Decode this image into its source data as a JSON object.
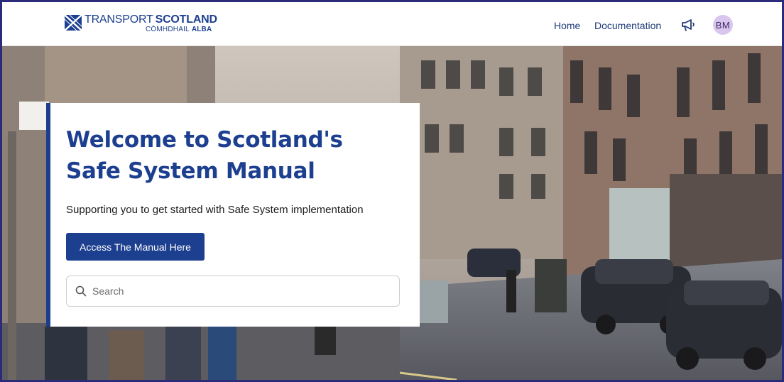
{
  "brand": {
    "name_light": "TRANSPORT",
    "name_bold": "SCOTLAND",
    "gaelic_light": "CÒMHDHAIL",
    "gaelic_bold": "ALBA",
    "color": "#1d3f8f"
  },
  "nav": {
    "home": "Home",
    "documentation": "Documentation",
    "announcement_icon": "megaphone-icon",
    "avatar_initials": "BM",
    "avatar_color": "#d9c6ee"
  },
  "hero": {
    "title": "Welcome to Scotland's Safe System Manual",
    "subtitle": "Supporting you to get started with Safe System implementation",
    "cta_label": "Access The Manual Here",
    "search_placeholder": "Search",
    "accent_color": "#1b3e8c",
    "background_description_icon": "street-photo"
  }
}
